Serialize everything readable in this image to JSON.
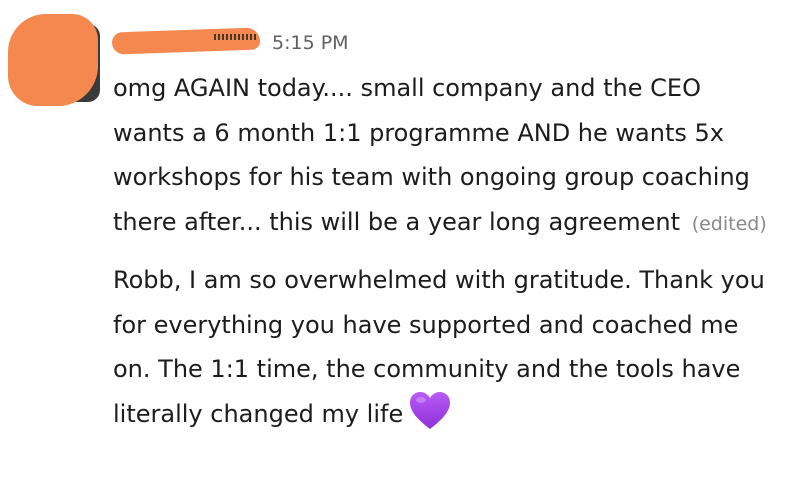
{
  "message": {
    "author_redacted": true,
    "timestamp": "5:15 PM",
    "paragraph1": "omg AGAIN today.... small company and the CEO wants a 6 month 1:1 programme AND he wants 5x workshops for his team with ongoing group coaching there after... this will be a year long agreement",
    "edited_label": "(edited)",
    "paragraph2": "Robb, I am so overwhelmed with gratitude. Thank you for everything you have supported and coached me on. The 1:1 time, the community and the tools have literally changed my life",
    "emoji_icon": "purple-heart-icon",
    "emoji_color": "#a342e8"
  },
  "colors": {
    "redaction": "#f4884f",
    "text": "#1d1c1d",
    "muted": "#616061"
  }
}
